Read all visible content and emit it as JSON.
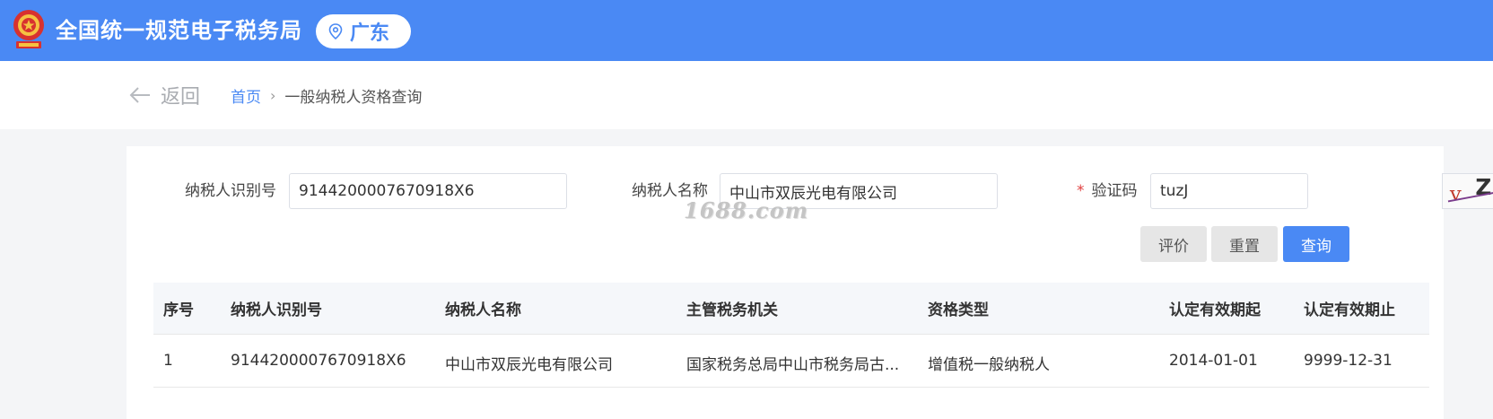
{
  "header": {
    "title": "全国统一规范电子税务局",
    "region": "广东",
    "brand_color": "#4a89f4",
    "emblem_icon": "national-tax-emblem",
    "location_icon": "location-pin-icon"
  },
  "nav": {
    "back_label": "返回",
    "breadcrumb": [
      {
        "label": "首页"
      },
      {
        "label": "一般纳税人资格查询"
      }
    ],
    "separator": "›"
  },
  "form": {
    "taxpayer_id": {
      "label": "纳税人识别号",
      "value": "9144200007670918X6"
    },
    "taxpayer_name": {
      "label": "纳税人名称",
      "value": "中山市双辰光电有限公司"
    },
    "captcha": {
      "required_mark": "*",
      "label": "验证码",
      "value": "tuzJ",
      "image_text": "vZZh"
    },
    "buttons": {
      "evaluate": "评价",
      "reset": "重置",
      "query": "查询"
    }
  },
  "table": {
    "columns": [
      "序号",
      "纳税人识别号",
      "纳税人名称",
      "主管税务机关",
      "资格类型",
      "认定有效期起",
      "认定有效期止"
    ],
    "rows": [
      [
        "1",
        "9144200007670918X6",
        "中山市双辰光电有限公司",
        "国家税务总局中山市税务局古...",
        "增值税一般纳税人",
        "2014-01-01",
        "9999-12-31"
      ]
    ]
  },
  "watermark": "1688.com"
}
